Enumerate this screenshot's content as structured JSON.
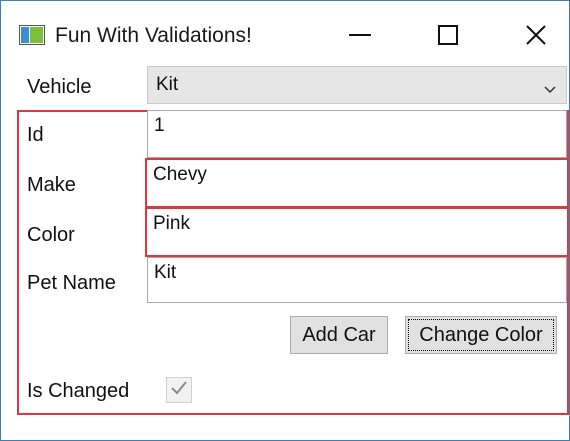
{
  "window": {
    "title": "Fun With Validations!"
  },
  "vehicle": {
    "label": "Vehicle",
    "selected": "Kit"
  },
  "fields": {
    "id": {
      "label": "Id",
      "value": "1"
    },
    "make": {
      "label": "Make",
      "value": "Chevy"
    },
    "color": {
      "label": "Color",
      "value": "Pink"
    },
    "pet_name": {
      "label": "Pet Name",
      "value": "Kit"
    }
  },
  "buttons": {
    "add_car": "Add Car",
    "change_color": "Change Color"
  },
  "is_changed": {
    "label": "Is Changed",
    "checked": true
  },
  "colors": {
    "error_border": "#e0363d",
    "window_border": "#3c7fb1",
    "combo_bg": "#e6e6e6",
    "button_bg": "#e1e1e1"
  },
  "icons": {
    "app": "app-icon",
    "minimize": "minimize-icon",
    "maximize": "maximize-icon",
    "close": "close-icon",
    "dropdown": "chevron-down-icon",
    "check": "check-icon"
  }
}
